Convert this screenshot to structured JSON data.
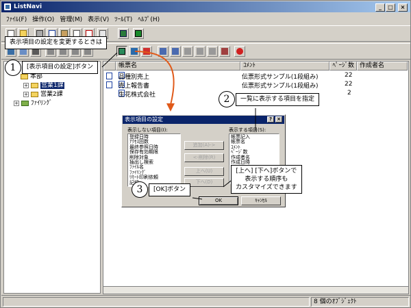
{
  "window": {
    "title": "ListNavi",
    "min": "_",
    "max": "□",
    "close": "×"
  },
  "menu": [
    "ﾌｧｲﾙ(F)",
    "操作(O)",
    "管理(M)",
    "表示(V)",
    "ﾂｰﾙ(T)",
    "ﾍﾙﾌﾟ(H)"
  ],
  "tree": {
    "root": "本部",
    "dept1": "営業1課",
    "dept2": "営業2課",
    "filing": "ﾌｧｲﾘﾝｸﾞ"
  },
  "list": {
    "columns": [
      "帳票名",
      "ｺﾒﾝﾄ",
      "ﾍﾟｰｼﾞ数",
      "作成者名"
    ],
    "rows": [
      {
        "name": "品種別売上",
        "comment": "伝票形式サンプル(1段組み)",
        "pages": "22"
      },
      {
        "name": "売上報告書",
        "comment": "伝票形式サンプル(1段組み)",
        "pages": "22"
      },
      {
        "name": "生花株式会社",
        "comment": "",
        "pages": "2"
      }
    ]
  },
  "status": {
    "count": "8 個のｵﾌﾞｼﾞｪｸﾄ"
  },
  "dialog": {
    "title": "表示項目の設定",
    "help": "?",
    "close": "×",
    "hidden_label": "表示しない項目(I):",
    "hidden_items": [
      "登録日時",
      "ｱｸｾｽ回数",
      "最終参照日時",
      "保存有効期限",
      "削除対象",
      "抽出し検索",
      "ﾌｧｲﾙ名",
      "ﾌｧｲﾘﾝｸﾞ",
      "ﾘﾓｰﾄ印刷依頼",
      "記録"
    ],
    "shown_label": "表示する項目(S):",
    "shown_items": [
      "帳票記入",
      "帳票名",
      "ｺﾒﾝﾄ",
      "ﾍﾟｰｼﾞ数",
      "作成者名",
      "作成日時"
    ],
    "add_button": "追加(A)->",
    "remove_button": "<-削除(R)",
    "up_button": "上へ(U)",
    "down_button": "下へ(D)",
    "ok_button": "OK",
    "cancel_button": "ｷｬﾝｾﾙ"
  },
  "annotations": {
    "top_note": "表示項目の設定を変更するときは",
    "step1_num": "1",
    "step1": "[表示項目の設定]ボタン",
    "step2_num": "2",
    "step2": "一覧に表示する項目を指定",
    "step3_num": "3",
    "step3": "[OK]ボタン",
    "note_line1": "[上へ] [下へ]ボタンで",
    "note_line2": "表示する順序も",
    "note_line3": "カスタマイズできます"
  },
  "colors": {
    "titlebar": "#0a246a",
    "selection": "#0a246a",
    "arrow": "#e05a1a"
  }
}
